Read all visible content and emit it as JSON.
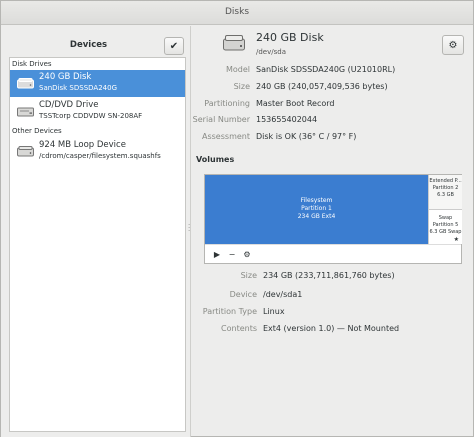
{
  "window": {
    "title": "Disks"
  },
  "sidebar": {
    "header": "Devices",
    "sections": [
      {
        "label": "Disk Drives"
      },
      {
        "label": "Other Devices"
      }
    ],
    "items": [
      {
        "name": "240 GB Disk",
        "detail": "SanDisk SDSSDA240G",
        "selected": true
      },
      {
        "name": "CD/DVD Drive",
        "detail": "TSSTcorp CDDVDW SN-208AF",
        "selected": false
      },
      {
        "name": "924 MB Loop Device",
        "detail": "/cdrom/casper/filesystem.squashfs",
        "selected": false
      }
    ]
  },
  "disk": {
    "title": "240 GB Disk",
    "path": "/dev/sda",
    "fields": [
      {
        "key": "Model",
        "value": "SanDisk SDSSDA240G (U21010RL)"
      },
      {
        "key": "Size",
        "value": "240 GB (240,057,409,536 bytes)"
      },
      {
        "key": "Partitioning",
        "value": "Master Boot Record"
      },
      {
        "key": "Serial Number",
        "value": "153655402044"
      },
      {
        "key": "Assessment",
        "value": "Disk is OK (36° C / 97° F)"
      }
    ]
  },
  "volumes": {
    "header": "Volumes",
    "main": {
      "l1": "Filesystem",
      "l2": "Partition 1",
      "l3": "234 GB Ext4"
    },
    "extended": {
      "l1": "Extended P...",
      "l2": "Partition 2",
      "l3": "6.3 GB"
    },
    "swap": {
      "l1": "Swap",
      "l2": "Partition 5",
      "l3": "6.3 GB Swap"
    }
  },
  "partition": {
    "fields": [
      {
        "key": "Size",
        "value": "234 GB (233,711,861,760 bytes)"
      },
      {
        "key": "Device",
        "value": "/dev/sda1"
      },
      {
        "key": "Partition Type",
        "value": "Linux"
      },
      {
        "key": "Contents",
        "value": "Ext4 (version 1.0) — Not Mounted"
      }
    ]
  },
  "colors": {
    "selection": "#4a90d9",
    "volume_main": "#3b7dd0"
  }
}
